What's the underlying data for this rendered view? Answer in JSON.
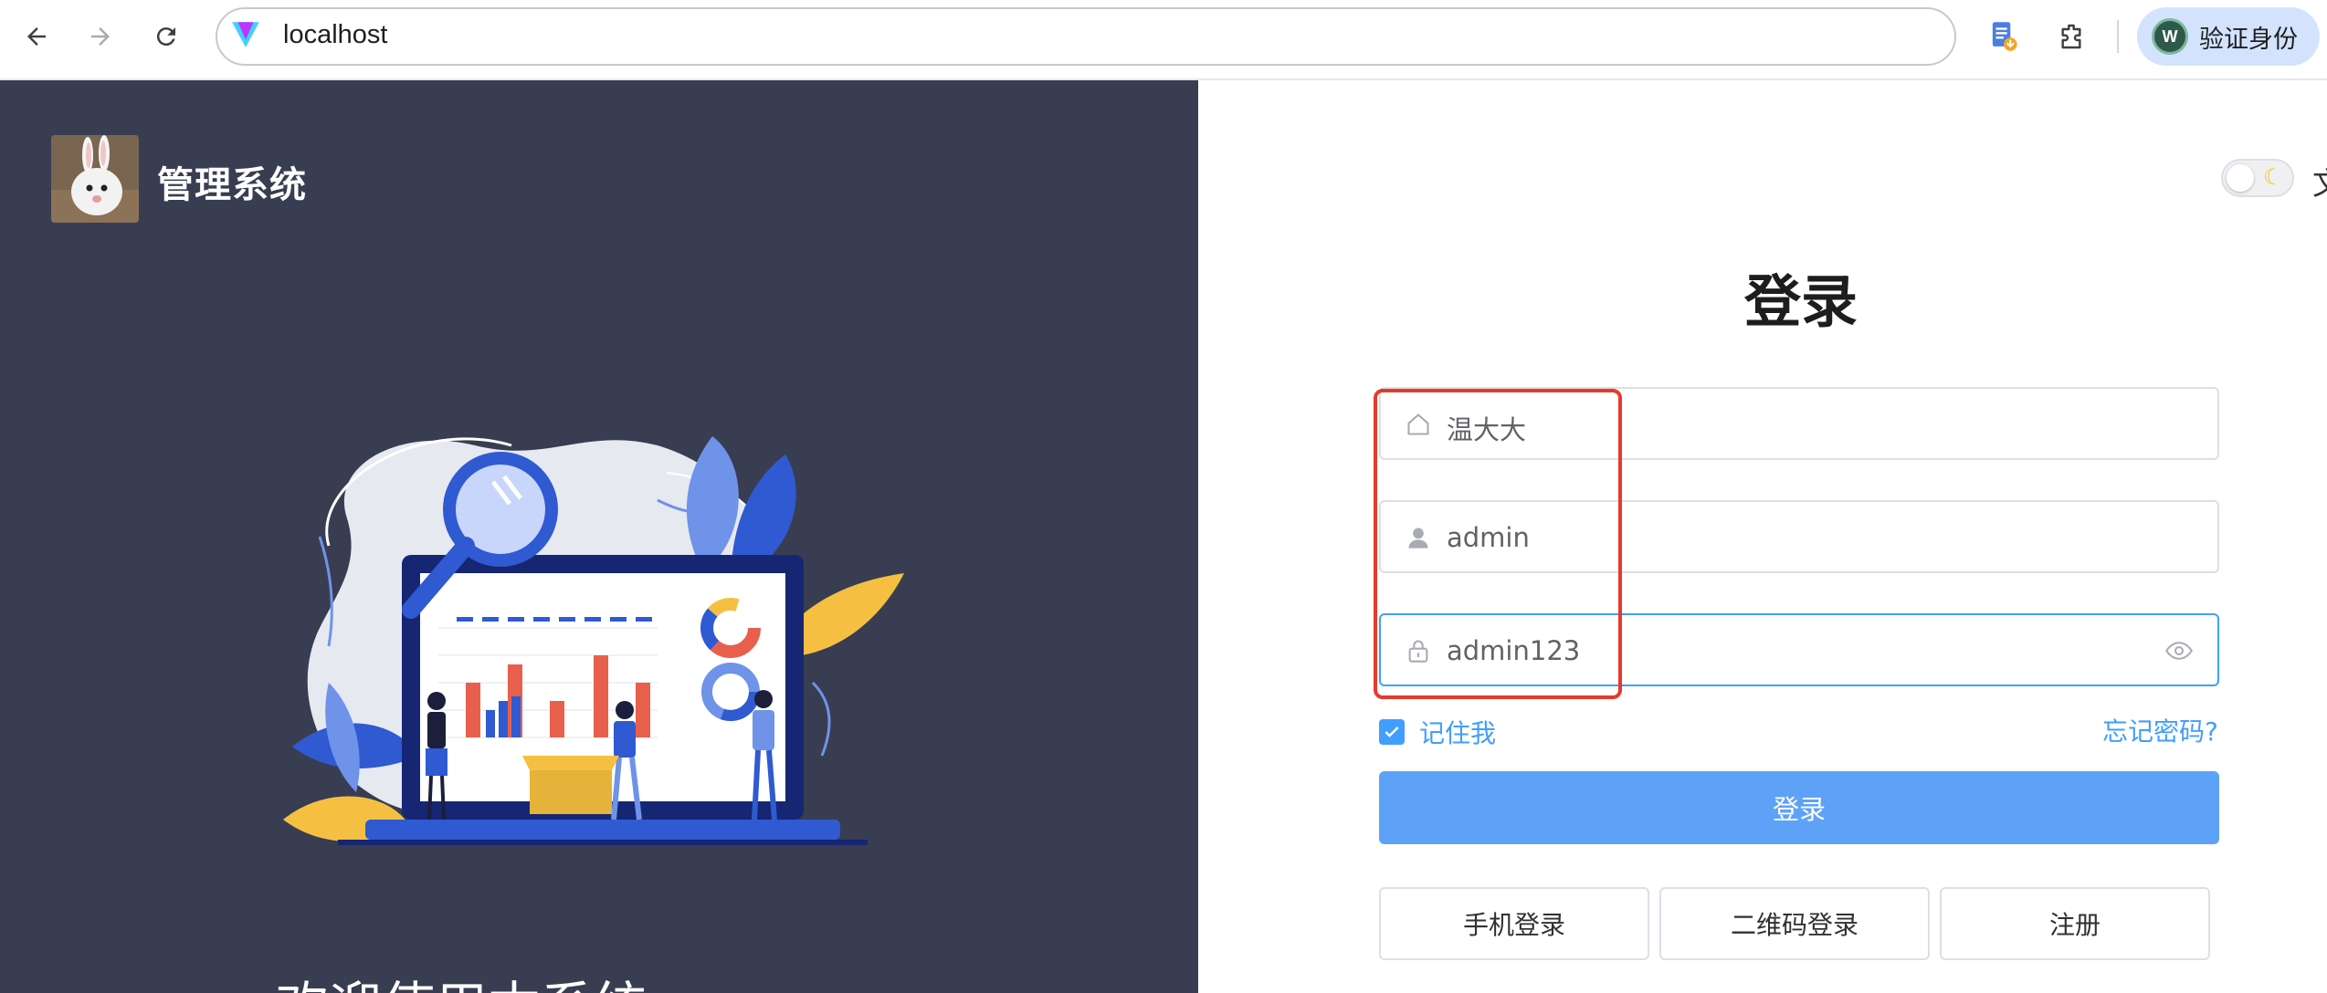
{
  "browser": {
    "url": "localhost",
    "profile_initial": "W",
    "profile_label": "验证身份"
  },
  "left_panel": {
    "system_title": "管理系统",
    "welcome_text": "欢迎使用本系统"
  },
  "login_form": {
    "title": "登录",
    "tenant_value": "温大大",
    "username_value": "admin",
    "password_value": "admin123",
    "remember_label": "记住我",
    "remember_checked": true,
    "forgot_label": "忘记密码?",
    "submit_label": "登录",
    "alt_buttons": [
      "手机登录",
      "二维码登录",
      "注册"
    ]
  },
  "header": {
    "lang_glyph": "文"
  },
  "colors": {
    "dark_panel": "#383d51",
    "primary": "#409eff",
    "login_button": "#5ea2f7",
    "highlight_box": "#e53a2c"
  }
}
